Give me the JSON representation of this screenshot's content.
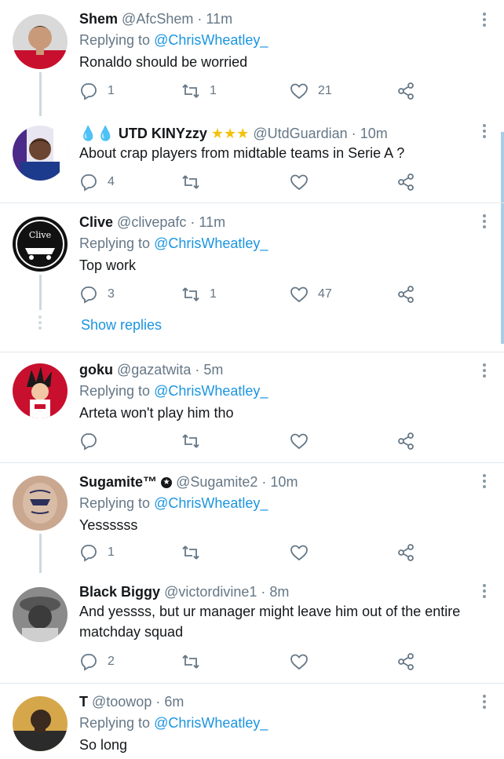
{
  "tweets": [
    {
      "name": "Shem",
      "handle": "@AfcShem",
      "time": "11m",
      "replying_prefix": "Replying to",
      "replying_to": "@ChrisWheatley_",
      "text": "Ronaldo should be worried",
      "replies": "1",
      "retweets": "1",
      "likes": "21"
    },
    {
      "name": "UTD KINYzzy",
      "name_prefix_icons": "blood-drop x2",
      "name_suffix_icons": "star x3",
      "handle": "@UtdGuardian",
      "time": "10m",
      "text": "About crap players from midtable teams in Serie A ?",
      "replies": "4",
      "retweets": "",
      "likes": ""
    },
    {
      "name": "Clive",
      "handle": "@clivepafc",
      "time": "11m",
      "replying_prefix": "Replying to",
      "replying_to": "@ChrisWheatley_",
      "text": "Top work",
      "replies": "3",
      "retweets": "1",
      "likes": "47",
      "avatar_text": "Clive"
    },
    {
      "name": "goku",
      "handle": "@gazatwita",
      "time": "5m",
      "replying_prefix": "Replying to",
      "replying_to": "@ChrisWheatley_",
      "text": "Arteta won't play him tho",
      "replies": "",
      "retweets": "",
      "likes": ""
    },
    {
      "name": "Sugamite™",
      "handle": "@Sugamite2",
      "time": "10m",
      "replying_prefix": "Replying to",
      "replying_to": "@ChrisWheatley_",
      "text": "Yessssss",
      "replies": "1",
      "retweets": "",
      "likes": ""
    },
    {
      "name": "Black Biggy",
      "handle": "@victordivine1",
      "time": "8m",
      "text": "And yessss, but ur manager might leave him out of the entire matchday squad",
      "replies": "2",
      "retweets": "",
      "likes": ""
    },
    {
      "name": "T",
      "handle": "@toowop",
      "time": "6m",
      "replying_prefix": "Replying to",
      "replying_to": "@ChrisWheatley_",
      "text": "So long"
    }
  ],
  "show_replies_label": "Show replies",
  "separator": "·",
  "colors": {
    "link": "#1b95e0",
    "muted": "#657786",
    "text": "#14171a",
    "divider": "#e1e8ed",
    "thread": "#cfd9de"
  },
  "icons": [
    "reply-icon",
    "retweet-icon",
    "like-icon",
    "share-icon",
    "more-icon"
  ]
}
